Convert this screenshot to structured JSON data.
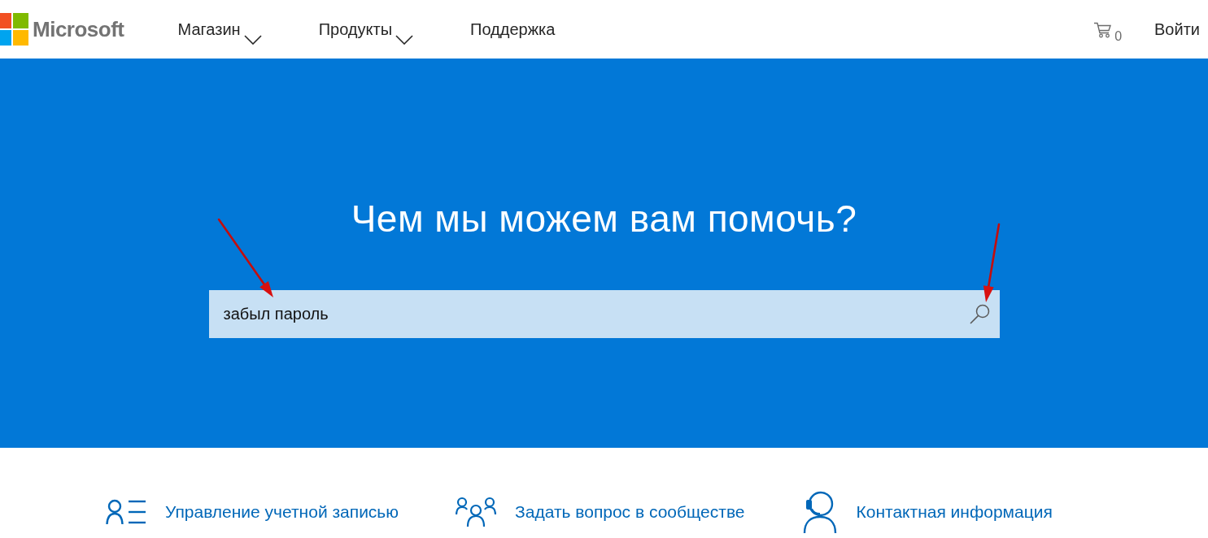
{
  "header": {
    "logo": {
      "text": "Microsoft"
    },
    "nav": [
      {
        "label": "Магазин",
        "dropdown": true
      },
      {
        "label": "Продукты",
        "dropdown": true
      },
      {
        "label": "Поддержка",
        "dropdown": false
      }
    ],
    "cart": {
      "count": "0"
    },
    "sign_in": "Войти"
  },
  "hero": {
    "title": "Чем мы можем вам помочь?",
    "search": {
      "value": "забыл пароль"
    }
  },
  "links": [
    {
      "kind": "account",
      "label": "Управление учетной записью"
    },
    {
      "kind": "community",
      "label": "Задать вопрос в сообществе"
    },
    {
      "kind": "contact",
      "label": "Контактная информация"
    }
  ]
}
